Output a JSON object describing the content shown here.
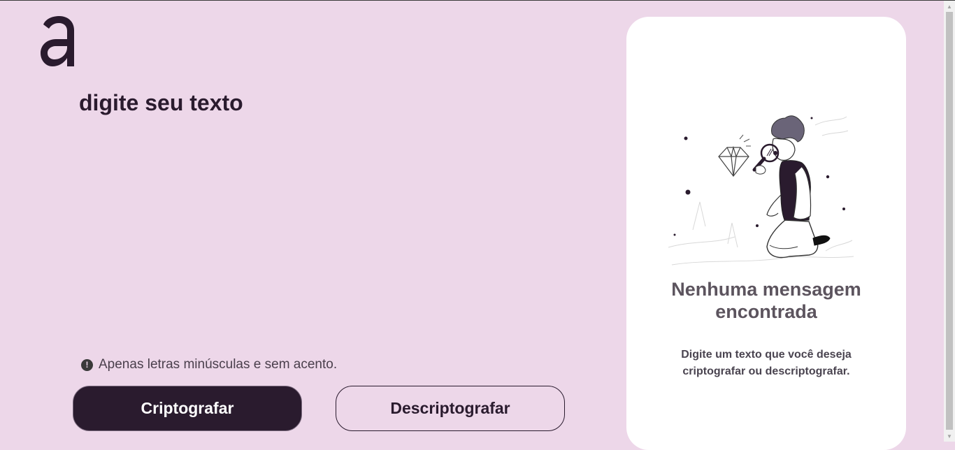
{
  "brand": {
    "logo_icon": "alura-a-logo-icon"
  },
  "editor": {
    "placeholder": "digite seu texto",
    "value": ""
  },
  "warning": {
    "icon": "exclamation-circle-icon",
    "text": "Apenas letras minúsculas e sem acento."
  },
  "actions": {
    "encrypt_label": "Criptografar",
    "decrypt_label": "Descriptografar"
  },
  "output": {
    "illustration": "person-with-magnifying-glass-illustration",
    "title": "Nenhuma mensagem encontrada",
    "description": "Digite um texto que você deseja criptografar ou descriptografar."
  },
  "colors": {
    "background": "#EDD7E9",
    "primary": "#2A1B2E",
    "panel": "#FFFFFF"
  }
}
